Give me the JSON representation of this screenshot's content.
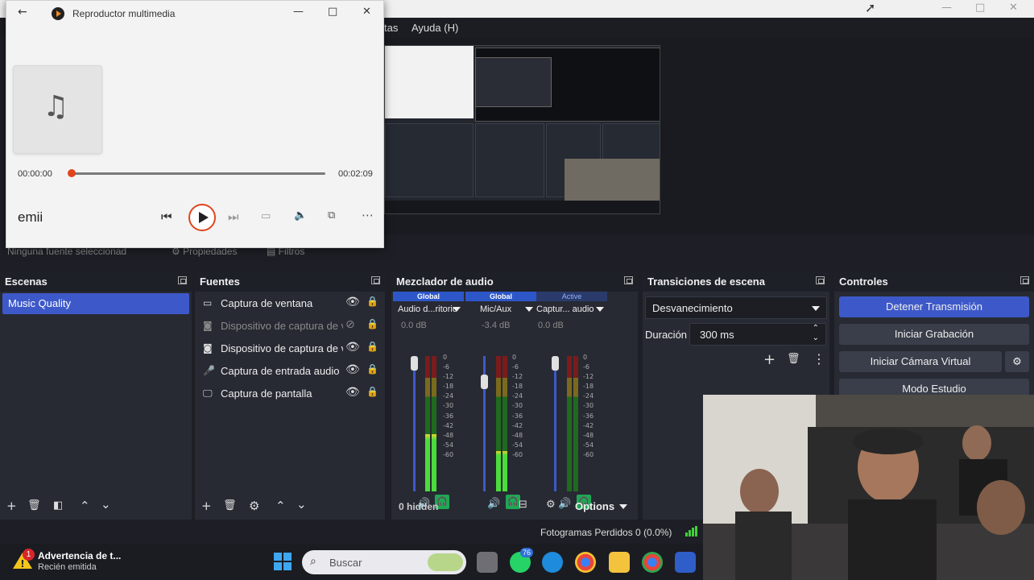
{
  "obs": {
    "window_controls": [
      "—",
      "□",
      "✕"
    ],
    "menu": [
      "tas",
      "Ayuda (H)"
    ],
    "no_source_selected": "Ninguna fuente seleccionad",
    "properties_label": "Propiedades",
    "filters_label": "Filtros"
  },
  "scenes": {
    "title": "Escenas",
    "items": [
      "Music Quality"
    ]
  },
  "sources": {
    "title": "Fuentes",
    "items": [
      {
        "label": "Captura de ventana",
        "icon": "window-icon",
        "visible": true
      },
      {
        "label": "Dispositivo de captura de v",
        "icon": "camera-icon",
        "visible": false
      },
      {
        "label": "Dispositivo de captura de v",
        "icon": "camera-icon",
        "visible": true
      },
      {
        "label": "Captura de entrada audio",
        "icon": "microphone-icon",
        "visible": true
      },
      {
        "label": "Captura de pantalla",
        "icon": "monitor-icon",
        "visible": true
      }
    ]
  },
  "mixer": {
    "title": "Mezclador de audio",
    "channels": [
      {
        "tag": "Global",
        "name": "Audio d...ritorio",
        "db": "0.0 dB",
        "level": 0.42,
        "fader": 1.0
      },
      {
        "tag": "Global",
        "name": "Mic/Aux",
        "db": "-3.4 dB",
        "level": 0.3,
        "fader": 0.85
      },
      {
        "tag": "Active",
        "name": "Captur... audio",
        "db": "0.0 dB",
        "level": 0.0,
        "fader": 1.0
      }
    ],
    "ticks": [
      "0",
      "-6",
      "-12",
      "-18",
      "-24",
      "-30",
      "-36",
      "-42",
      "-48",
      "-54",
      "-60"
    ],
    "hidden": "0 hidden",
    "options": "Options"
  },
  "transitions": {
    "title": "Transiciones de escena",
    "selected": "Desvanecimiento",
    "duration_label": "Duración",
    "duration_value": "300 ms"
  },
  "controls": {
    "title": "Controles",
    "stop_stream": "Detener Transmisión",
    "start_record": "Iniciar Grabación",
    "virtual_cam": "Iniciar Cámara Virtual",
    "studio_mode": "Modo Estudio"
  },
  "status": {
    "dropped_frames": "Fotogramas Perdidos 0 (0.0%)"
  },
  "player": {
    "title": "Reproductor multimedia",
    "current_time": "00:00:00",
    "total_time": "00:02:09",
    "track": "emii",
    "progress": 0.0
  },
  "taskbar": {
    "notification_title": "Advertencia de t...",
    "notification_sub": "Recién emitida",
    "notification_badge": "1",
    "search_placeholder": "Buscar",
    "whatsapp_badge": "76"
  },
  "colors": {
    "accent": "#3d59c9",
    "meter_green": "#4bdc3c",
    "headphone_green": "#1ea854"
  }
}
